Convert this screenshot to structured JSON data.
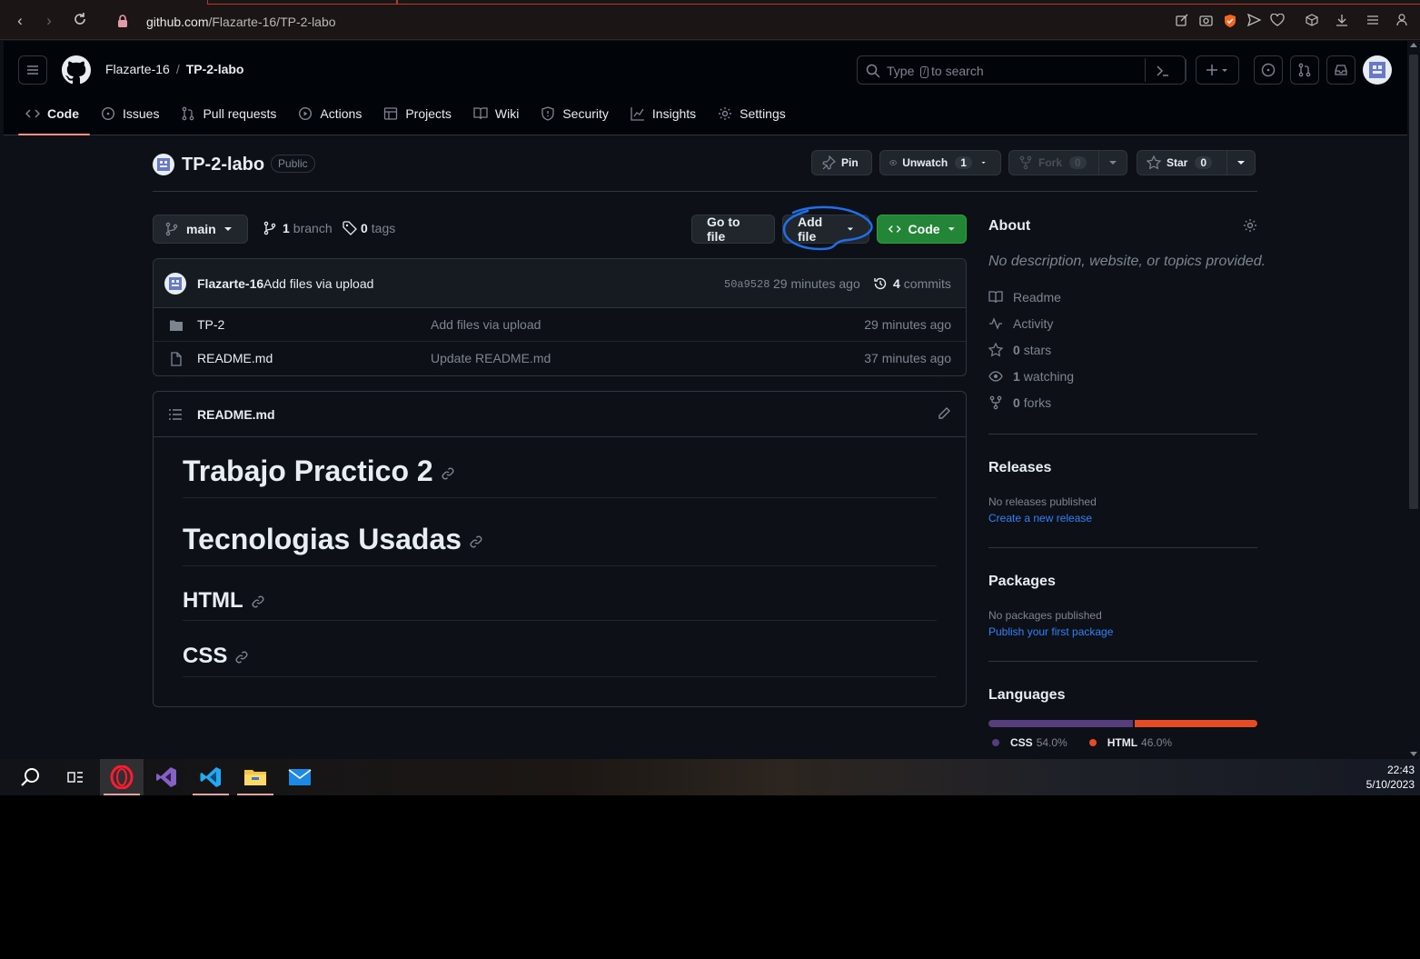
{
  "browser": {
    "url_host": "github.com",
    "url_path": "/Flazarte-16/TP-2-labo"
  },
  "header": {
    "owner": "Flazarte-16",
    "separator": "/",
    "repo": "TP-2-labo",
    "search_prefix": "Type",
    "search_key": "/",
    "search_suffix": "to search"
  },
  "tabs": [
    {
      "label": "Code",
      "icon": "code-icon"
    },
    {
      "label": "Issues",
      "icon": "issue-icon"
    },
    {
      "label": "Pull requests",
      "icon": "pull-request-icon"
    },
    {
      "label": "Actions",
      "icon": "play-icon"
    },
    {
      "label": "Projects",
      "icon": "table-icon"
    },
    {
      "label": "Wiki",
      "icon": "book-icon"
    },
    {
      "label": "Security",
      "icon": "shield-icon"
    },
    {
      "label": "Insights",
      "icon": "graph-icon"
    },
    {
      "label": "Settings",
      "icon": "gear-icon"
    }
  ],
  "repo": {
    "title": "TP-2-labo",
    "visibility": "Public",
    "pin_label": "Pin",
    "unwatch_label": "Unwatch",
    "watch_count": "1",
    "fork_label": "Fork",
    "fork_count": "0",
    "star_label": "Star",
    "star_count": "0"
  },
  "branchbar": {
    "branch": "main",
    "branch_count": "1",
    "branch_word": "branch",
    "tag_count": "0",
    "tag_word": "tags",
    "goto_label": "Go to file",
    "addfile_label": "Add file",
    "code_label": "Code"
  },
  "commit": {
    "author": "Flazarte-16",
    "message": "Add files via upload",
    "sha": "50a9528",
    "age": "29 minutes ago",
    "commit_count": "4",
    "commit_word": "commits"
  },
  "files": [
    {
      "name": "TP-2",
      "type": "folder",
      "message": "Add files via upload",
      "age": "29 minutes ago"
    },
    {
      "name": "README.md",
      "type": "file",
      "message": "Update README.md",
      "age": "37 minutes ago"
    }
  ],
  "readme": {
    "filename": "README.md",
    "headings": [
      {
        "text": "Trabajo Practico 2",
        "level": 1
      },
      {
        "text": "Tecnologias Usadas",
        "level": 1
      },
      {
        "text": "HTML",
        "level": 2
      },
      {
        "text": "CSS",
        "level": 2
      }
    ]
  },
  "about": {
    "title": "About",
    "description": "No description, website, or topics provided.",
    "readme": "Readme",
    "activity": "Activity",
    "stars_count": "0",
    "stars_word": "stars",
    "watching_count": "1",
    "watching_word": "watching",
    "forks_count": "0",
    "forks_word": "forks"
  },
  "releases": {
    "title": "Releases",
    "empty": "No releases published",
    "link": "Create a new release"
  },
  "packages": {
    "title": "Packages",
    "empty": "No packages published",
    "link": "Publish your first package"
  },
  "languages": {
    "title": "Languages",
    "items": [
      {
        "name": "CSS",
        "percent": "54.0%",
        "value": 54.0,
        "color": "#563d7c"
      },
      {
        "name": "HTML",
        "percent": "46.0%",
        "value": 46.0,
        "color": "#e34c26"
      }
    ]
  },
  "taskbar": {
    "time": "22:43",
    "date": "5/10/2023"
  },
  "colors": {
    "accent_green": "#238636",
    "link_blue": "#2f81f7",
    "annotation_blue": "#1f6feb",
    "tab_underline": "#fd8c73"
  }
}
